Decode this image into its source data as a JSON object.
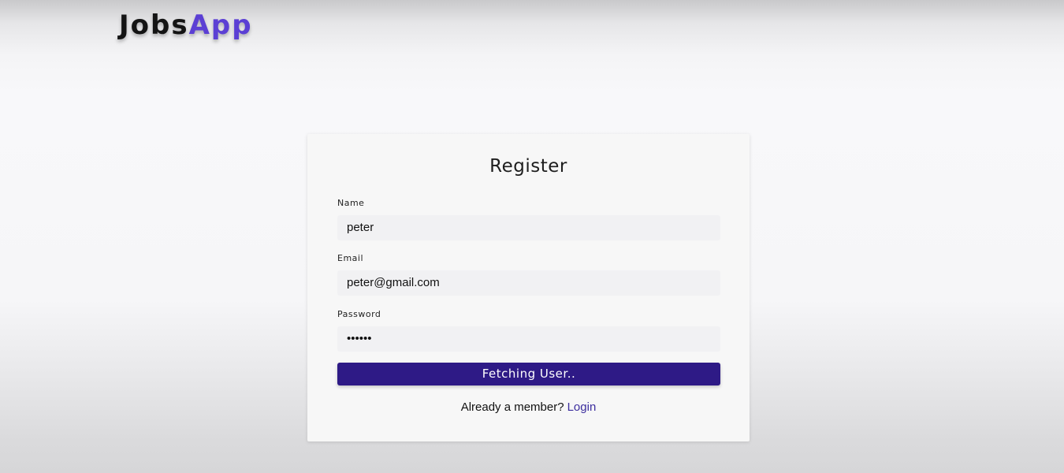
{
  "header": {
    "logo_part1": "Jobs",
    "logo_part2": "App"
  },
  "form": {
    "title": "Register",
    "name": {
      "label": "Name",
      "value": "peter"
    },
    "email": {
      "label": "Email",
      "value": "peter@gmail.com"
    },
    "password": {
      "label": "Password",
      "value": "••••••"
    },
    "submit_label": "Fetching User..",
    "member_text": "Already a member?",
    "login_link": "Login"
  },
  "colors": {
    "brand_accent": "#5b3fd4",
    "button_bg": "#2e1a86",
    "link": "#3c2e9e"
  }
}
